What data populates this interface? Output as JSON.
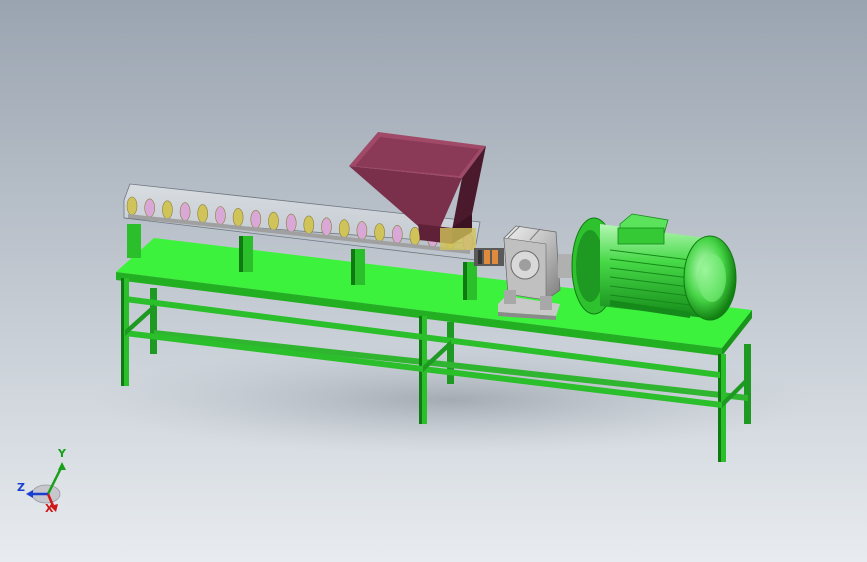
{
  "viewport": {
    "background_top": "#9aa4b0",
    "background_bottom": "#e8ecf0"
  },
  "colors": {
    "frame_green": "#2bbf2b",
    "frame_green_dark": "#0f7a12",
    "table_top": "#3df23d",
    "table_top_edge": "#22b022",
    "motor_green": "#42d442",
    "motor_green_light": "#9cf09c",
    "motor_green_dark": "#15891a",
    "hopper": "#7a2f4a",
    "hopper_dark": "#4a1a2c",
    "hopper_light": "#a04a68",
    "screw_yellow": "#cfc35a",
    "screw_pink": "#d9a8d6",
    "gearbox_grey": "#b8b8b8",
    "coupling_orange": "#e08a3c"
  },
  "triad": {
    "x_label": "X",
    "y_label": "Y",
    "z_label": "Z",
    "x_color": "#d01818",
    "y_color": "#18a018",
    "z_color": "#1a3fd0"
  }
}
